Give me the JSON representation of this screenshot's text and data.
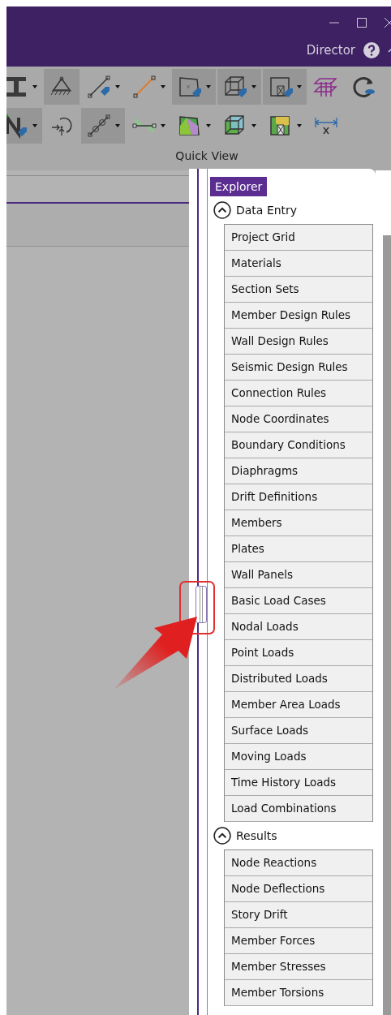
{
  "title_bar": {
    "user": "Director"
  },
  "toolbar": {
    "rows": [
      [
        {
          "kind": "beam",
          "active": false,
          "dropdown": true
        },
        {
          "kind": "support",
          "active": true,
          "dropdown": false
        },
        {
          "kind": "member",
          "active": false,
          "dropdown": true
        },
        {
          "kind": "line",
          "active": false,
          "dropdown": true
        },
        {
          "kind": "plate",
          "active": true,
          "dropdown": true
        },
        {
          "kind": "solid",
          "active": true,
          "dropdown": true
        },
        {
          "kind": "wall",
          "active": true,
          "dropdown": true
        },
        {
          "kind": "floors",
          "active": false,
          "dropdown": false
        },
        {
          "kind": "refresh",
          "active": false,
          "dropdown": false
        }
      ],
      [
        {
          "kind": "node",
          "active": true,
          "dropdown": true
        },
        {
          "kind": "rotation",
          "active": false,
          "dropdown": false
        },
        {
          "kind": "release",
          "active": true,
          "dropdown": true
        },
        {
          "kind": "load",
          "active": false,
          "dropdown": true
        },
        {
          "kind": "plate-contour",
          "active": false,
          "dropdown": true
        },
        {
          "kind": "solid-contour",
          "active": false,
          "dropdown": true
        },
        {
          "kind": "wall-contour",
          "active": false,
          "dropdown": true
        },
        {
          "kind": "dimension",
          "active": false,
          "dropdown": false
        }
      ]
    ],
    "group_label": "Quick View"
  },
  "explorer": {
    "title": "Explorer",
    "sections": [
      {
        "title": "Data Entry",
        "expanded": true,
        "items": [
          "Project Grid",
          "Materials",
          "Section Sets",
          "Member Design Rules",
          "Wall Design Rules",
          "Seismic Design Rules",
          "Connection Rules",
          "Node Coordinates",
          "Boundary Conditions",
          "Diaphragms",
          "Drift Definitions",
          "Members",
          "Plates",
          "Wall Panels",
          "Basic Load Cases",
          "Nodal Loads",
          "Point Loads",
          "Distributed Loads",
          "Member Area Loads",
          "Surface Loads",
          "Moving Loads",
          "Time History Loads",
          "Load Combinations"
        ]
      },
      {
        "title": "Results",
        "expanded": true,
        "items": [
          "Node Reactions",
          "Node Deflections",
          "Story Drift",
          "Member Forces",
          "Member Stresses",
          "Member Torsions"
        ]
      }
    ]
  }
}
